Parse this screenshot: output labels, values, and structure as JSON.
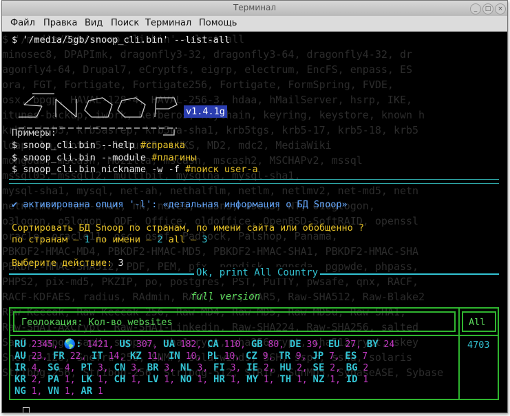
{
  "window": {
    "title": "Терминал",
    "buttons": [
      "_",
      "□",
      "×"
    ]
  },
  "menu": [
    "Файл",
    "Правка",
    "Вид",
    "Поиск",
    "Терминал",
    "Помощь"
  ],
  "bg_lines": [
    "$ '/media/5gb/snoop_cli.bin' --list-all",
    "minosec8, DPAPImk, dragonfly3-32, dragonfly3-64, dragonfly4-32, dr",
    "agonfly4-64, Drupal7, eCryptfs, eigrp, electrum, EncFS, enpass, ES",
    "ora, FGT, Fortigate, Fortigate256, Fortigate, FormSpring, FVDE,",
    "osx, bpgp, HAVAL-128-4, HAVAL-256-3, hdaa, hMailServer, hsrp, IKE,",
    "itunes-backup, iwork, Kerberos, keychain, keyring, keystore, known h",
    "krb4, krb5, krb5asrep, krb5pa-sha1, krb5tgs, krb5-17, krb5-18, krb5",
    "ldap, lm, lotus5, lotus85, LUKS, MD2, mdc2, MediaWiki",
    "mongodb, mscash, Mozilla, mscash, mscash2, MSCHAPv2, mssql",
    "mssql05, mssql12, multibit, mysqlna, mysql-sha1,",
    "mysql-sha1, mysql, net-ah, nethalflm, netlm, netlmv2, net-md5, netn",
    "netntlmv2, net-sha1, nk, notes, md5ns, nsec3, NT, o10glogon,",
    "o3logon, o5logon, ODF, Office, oldoffice, OpenBSD-SoftRAID, openssl",
    "oracle, oracle11, osc, ospf, Padlock, Palshop, Panama,",
    "PBKDF2-HMAC-MD4, PBKDF2-HMAC-MD5, PBKDF2-HMAC-SHA1, PBKDF2-HMAC-SHA",
    "PBKDF2-HMAC-SHA512, PDF, PEM, pfx, pgpdisk, pgpsda, pgpwde, phpass,",
    "PHPS2, pix-md5, PKZIP, po, postgres, PST, PuTTY, pwsafe, qnx, RACF,",
    "RACF-KDFAES, radius, RAdmin, RAKP, rar, RAR5, Raw-SHA512, Raw-Blake2",
    "Raw-Keccak, Raw-Keccak-256, Raw-MD4, Raw-MD5, Raw-MD5u, Raw-SHA1,",
    "Raw-SHA1-AxCrypt, Raw-SHA1-Linkedin, Raw-SHA224, Raw-SHA256, salted",
    "SapB, sapg, sapH, sappse, sha1crypt, sha256crypt, sha512crypt, skey",
    "Snefru-128, Snefru-256, SNMP, solarwinds, SSH, sspr, ssha, solaris",
    "Stribog-256, Stribog-256, Stribog-512, STRIP, SunMD5, SybaseASE, Sybase"
  ],
  "cmd": "$ '/media/5gb/snoop_cli.bin' --list-all",
  "version": "v1.4.1g",
  "examples_title": "Примеры:",
  "examples": [
    {
      "cmd": "$ snoop_cli.bin --help",
      "comment": " #справка"
    },
    {
      "cmd": "$ snoop_cli.bin --module",
      "comment": " #плагины"
    },
    {
      "cmd": "$ snoop_cli.bin nickname -w -f",
      "comment": " #поиск user-a"
    }
  ],
  "activated": "✔ активирована опция '-l': «детальная информация о БД Snoop»",
  "sort_prompt": "Сортировать БД Snoop по странам, по имени сайта или обобщенно ?",
  "sort_opts": {
    "p1": "по странам — ",
    "n1": "1",
    "p2": " по имени — ",
    "n2": "2",
    "p3": " all — ",
    "n3": "3"
  },
  "choose_label": "Выберите действие: ",
  "choose_value": "3",
  "ok_label": "Ok, print All Country",
  "full_label": "full version",
  "table": {
    "geo_header": "Геолокация: Кол-во websites",
    "all_header": "All",
    "total": "4703",
    "rows": [
      [
        [
          "RU",
          "2345"
        ],
        [
          "🌎:",
          "1421"
        ],
        [
          "US",
          "307"
        ],
        [
          "UA",
          "182"
        ],
        [
          "CA",
          "110"
        ],
        [
          "GB",
          "80"
        ],
        [
          "DE",
          "39"
        ],
        [
          "EU",
          "27"
        ],
        [
          "BY",
          "24"
        ]
      ],
      [
        [
          "AU",
          "23"
        ],
        [
          "FR",
          "22"
        ],
        [
          "IT",
          "14"
        ],
        [
          "KZ",
          "11"
        ],
        [
          "IN",
          "10"
        ],
        [
          "PL",
          "10"
        ],
        [
          "CZ",
          "9"
        ],
        [
          "TR",
          "9"
        ],
        [
          "JP",
          "7"
        ],
        [
          "ES",
          "7"
        ]
      ],
      [
        [
          "IR",
          "4"
        ],
        [
          "SG",
          "4"
        ],
        [
          "PT",
          "3"
        ],
        [
          "CN",
          "3"
        ],
        [
          "BR",
          "3"
        ],
        [
          "NL",
          "3"
        ],
        [
          "FI",
          "3"
        ],
        [
          "IE",
          "2"
        ],
        [
          "HU",
          "2"
        ],
        [
          "SE",
          "2"
        ],
        [
          "BG",
          "2"
        ]
      ],
      [
        [
          "KR",
          "2"
        ],
        [
          "PA",
          "1"
        ],
        [
          "LK",
          "1"
        ],
        [
          "CH",
          "1"
        ],
        [
          "LV",
          "1"
        ],
        [
          "NO",
          "1"
        ],
        [
          "HR",
          "1"
        ],
        [
          "MY",
          "1"
        ],
        [
          "TH",
          "1"
        ],
        [
          "NZ",
          "1"
        ],
        [
          "ID",
          "1"
        ]
      ],
      [
        [
          "NG",
          "1"
        ],
        [
          "VN",
          "1"
        ],
        [
          "AR",
          "1"
        ]
      ]
    ]
  },
  "colors": {
    "green": "#5ad65a",
    "cyan": "#33c3d3",
    "magenta": "#c23ac2",
    "yellow": "#e6c229",
    "version_bg": "#2a3db0"
  }
}
